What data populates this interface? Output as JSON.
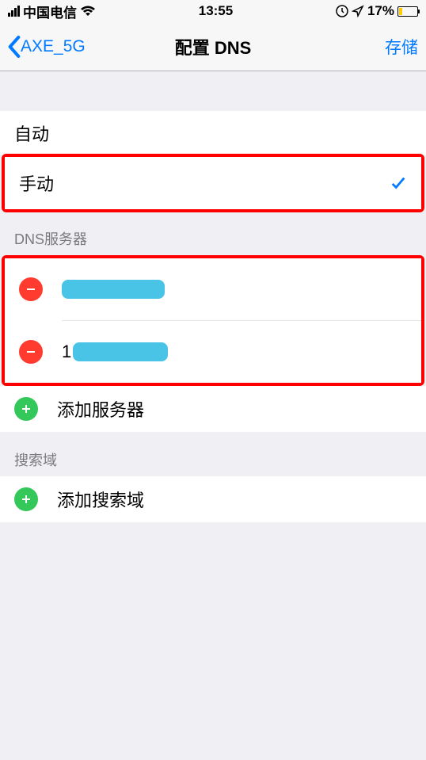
{
  "status": {
    "carrier": "中国电信",
    "time": "13:55",
    "battery_pct": "17%"
  },
  "nav": {
    "back_label": "AXE_5G",
    "title": "配置 DNS",
    "save_label": "存储"
  },
  "mode": {
    "auto": "自动",
    "manual": "手动"
  },
  "dns_section": {
    "header": "DNS服务器",
    "server1_prefix": "",
    "server2_prefix": "1",
    "add_label": "添加服务器"
  },
  "search_section": {
    "header": "搜索域",
    "add_label": "添加搜索域"
  }
}
